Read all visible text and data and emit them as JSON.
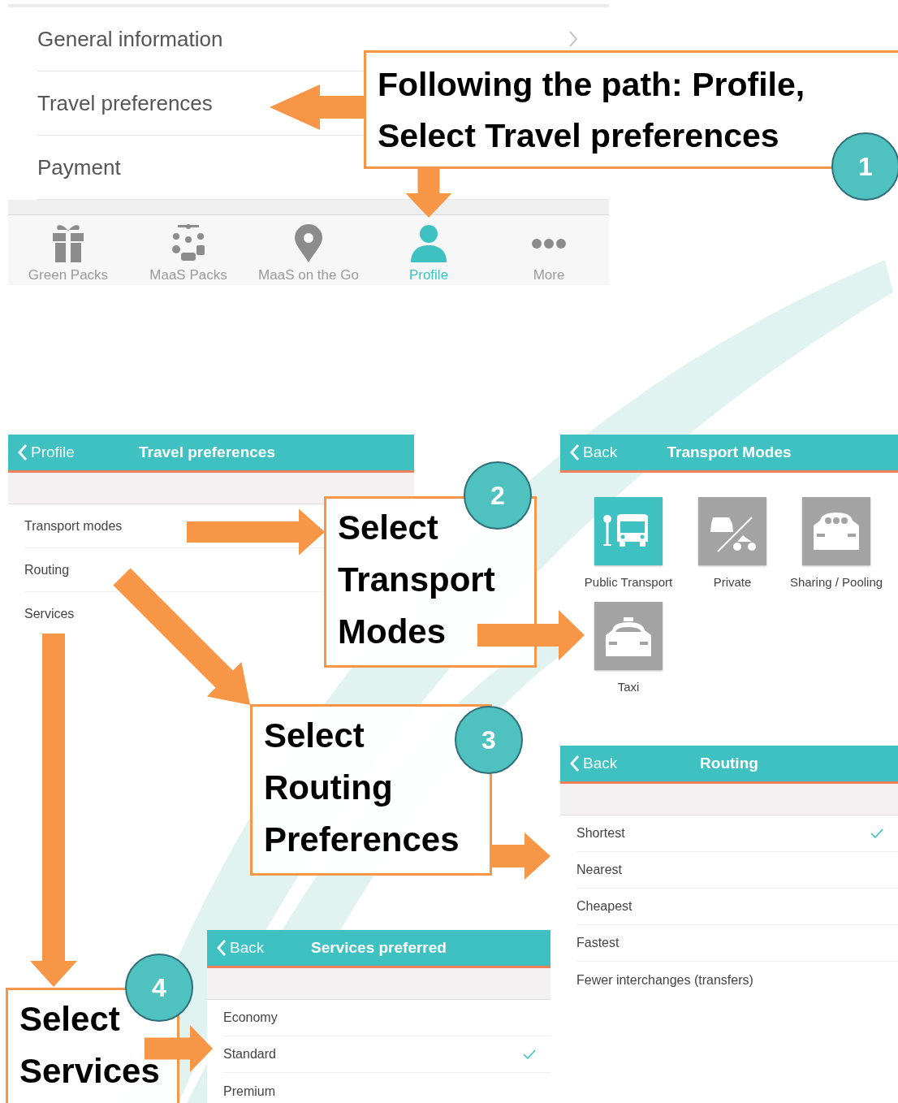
{
  "profile_menu": {
    "items": [
      {
        "label": "General information"
      },
      {
        "label": "Travel preferences"
      },
      {
        "label": "Payment"
      }
    ],
    "tab_bar": [
      {
        "label": "Green Packs",
        "selected": false
      },
      {
        "label": "MaaS Packs",
        "selected": false
      },
      {
        "label": "MaaS on the Go",
        "selected": false
      },
      {
        "label": "Profile",
        "selected": true
      },
      {
        "label": "More",
        "selected": false
      }
    ]
  },
  "travel_preferences": {
    "back": "Profile",
    "title": "Travel preferences",
    "items": [
      {
        "label": "Transport modes"
      },
      {
        "label": "Routing"
      },
      {
        "label": "Services"
      }
    ]
  },
  "transport_modes": {
    "back": "Back",
    "title": "Transport Modes",
    "modes": [
      {
        "label": "Public Transport",
        "selected": true
      },
      {
        "label": "Private",
        "selected": false
      },
      {
        "label": "Sharing / Pooling",
        "selected": false
      },
      {
        "label": "Taxi",
        "selected": false
      }
    ]
  },
  "routing": {
    "back": "Back",
    "title": "Routing",
    "options": [
      {
        "label": "Shortest",
        "selected": true
      },
      {
        "label": "Nearest",
        "selected": false
      },
      {
        "label": "Cheapest",
        "selected": false
      },
      {
        "label": "Fastest",
        "selected": false
      },
      {
        "label": "Fewer interchanges (transfers)",
        "selected": false
      }
    ]
  },
  "services": {
    "back": "Back",
    "title": "Services preferred",
    "options": [
      {
        "label": "Economy",
        "selected": false
      },
      {
        "label": "Standard",
        "selected": true
      },
      {
        "label": "Premium",
        "selected": false
      }
    ]
  },
  "callouts": [
    {
      "number": "1",
      "text": "Following the path: Profile,\nSelect Travel preferences"
    },
    {
      "number": "2",
      "text": "Select\nTransport\nModes"
    },
    {
      "number": "3",
      "text": "Select\nRouting\nPreferences"
    },
    {
      "number": "4",
      "text": "Select\nServices"
    }
  ]
}
